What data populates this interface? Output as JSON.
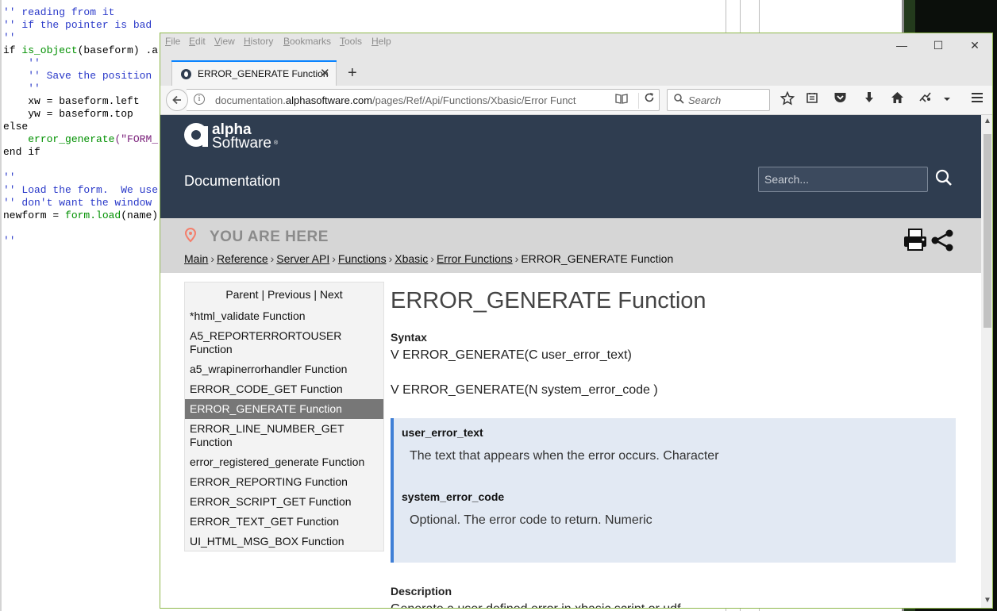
{
  "editor": {
    "lines": [
      [
        {
          "t": "'' reading from it",
          "c": "c-com"
        }
      ],
      [
        {
          "t": "'' if the pointer is bad",
          "c": "c-com"
        }
      ],
      [
        {
          "t": "''",
          "c": "c-com"
        }
      ],
      [
        {
          "t": "if ",
          "c": ""
        },
        {
          "t": "is_object",
          "c": "c-fn"
        },
        {
          "t": "(baseform) .a",
          "c": ""
        }
      ],
      [
        {
          "t": "    ''",
          "c": "c-com"
        }
      ],
      [
        {
          "t": "    '' Save the position",
          "c": "c-com"
        }
      ],
      [
        {
          "t": "    ''",
          "c": "c-com"
        }
      ],
      [
        {
          "t": "    xw = baseform.left",
          "c": ""
        }
      ],
      [
        {
          "t": "    yw = baseform.top",
          "c": ""
        }
      ],
      [
        {
          "t": "else",
          "c": ""
        }
      ],
      [
        {
          "t": "    ",
          "c": ""
        },
        {
          "t": "error_generate",
          "c": "c-fn"
        },
        {
          "t": "(\"FORM_",
          "c": "c-str"
        }
      ],
      [
        {
          "t": "end if",
          "c": ""
        }
      ],
      [
        {
          "t": "",
          "c": ""
        }
      ],
      [
        {
          "t": "''",
          "c": "c-com"
        }
      ],
      [
        {
          "t": "'' Load the form.  We use",
          "c": "c-com"
        }
      ],
      [
        {
          "t": "'' don't want the window",
          "c": "c-com"
        }
      ],
      [
        {
          "t": "newform = ",
          "c": ""
        },
        {
          "t": "form.load",
          "c": "c-fn"
        },
        {
          "t": "(name)",
          "c": ""
        }
      ],
      [
        {
          "t": "",
          "c": ""
        }
      ],
      [
        {
          "t": "''",
          "c": "c-com"
        }
      ]
    ]
  },
  "browser": {
    "menu": {
      "file": {
        "u": "F",
        "rest": "ile"
      },
      "edit": {
        "u": "E",
        "rest": "dit"
      },
      "view": {
        "u": "V",
        "rest": "iew"
      },
      "history": {
        "u": "H",
        "rest": "istory"
      },
      "bookmarks": {
        "u": "B",
        "rest": "ookmarks"
      },
      "tools": {
        "u": "T",
        "rest": "ools"
      },
      "help": {
        "u": "H",
        "rest": "elp"
      }
    },
    "window_controls": {
      "minimize": "—",
      "maximize": "☐",
      "close": "✕"
    },
    "tab": {
      "title": "ERROR_GENERATE Function",
      "close": "✕"
    },
    "new_tab": "+",
    "url": {
      "prefix": "documentation.",
      "domain": "alphasoftware.com",
      "path": "/pages/Ref/Api/Functions/Xbasic/Error Funct"
    },
    "search_placeholder": "Search",
    "icons": [
      "bookmark-star-icon",
      "reading-list-icon",
      "pocket-icon",
      "download-icon",
      "home-icon",
      "extension-icon",
      "menu-overflow-icon",
      "hamburger-menu-icon"
    ]
  },
  "site": {
    "logo": {
      "line1": "alpha",
      "line2": "Software",
      "reg": "®"
    },
    "doc_title": "Documentation",
    "search_placeholder": "Search...",
    "you_are_here": "YOU ARE HERE",
    "breadcrumb": [
      {
        "label": "Main",
        "link": true
      },
      {
        "label": "Reference",
        "link": true
      },
      {
        "label": "Server API",
        "link": true
      },
      {
        "label": "Functions",
        "link": true
      },
      {
        "label": "Xbasic",
        "link": true
      },
      {
        "label": "Error Functions",
        "link": true
      },
      {
        "label": "ERROR_GENERATE Function",
        "link": false
      }
    ],
    "breadcrumb_sep": "›",
    "sidenav": {
      "parent": "Parent",
      "previous": "Previous",
      "next": "Next",
      "divider": "|",
      "items": [
        {
          "label": "*html_validate Function",
          "active": false
        },
        {
          "label": "A5_REPORTERRORTOUSER Function",
          "active": false
        },
        {
          "label": "a5_wrapinerrorhandler Function",
          "active": false
        },
        {
          "label": "ERROR_CODE_GET Function",
          "active": false
        },
        {
          "label": "ERROR_GENERATE Function",
          "active": true
        },
        {
          "label": "ERROR_LINE_NUMBER_GET Function",
          "active": false
        },
        {
          "label": "error_registered_generate Function",
          "active": false
        },
        {
          "label": "ERROR_REPORTING Function",
          "active": false
        },
        {
          "label": "ERROR_SCRIPT_GET Function",
          "active": false
        },
        {
          "label": "ERROR_TEXT_GET Function",
          "active": false
        },
        {
          "label": "UI_HTML_MSG_BOX Function",
          "active": false
        }
      ]
    },
    "content": {
      "title": "ERROR_GENERATE Function",
      "syntax_label": "Syntax",
      "syntax_1": "V ERROR_GENERATE(C user_error_text)",
      "syntax_2": "V ERROR_GENERATE(N system_error_code )",
      "params": [
        {
          "name": "user_error_text",
          "desc": "The text that appears when the error occurs. Character"
        },
        {
          "name": "system_error_code",
          "desc": "Optional. The error code to return. Numeric"
        }
      ],
      "description_label": "Description",
      "description": "Generate a user defined error in xbasic script or udf."
    }
  },
  "colors": {
    "header_bg": "#2f3d50",
    "accent": "#3f7fd6",
    "active_nav": "#777777",
    "window_border": "#8fb84c"
  }
}
